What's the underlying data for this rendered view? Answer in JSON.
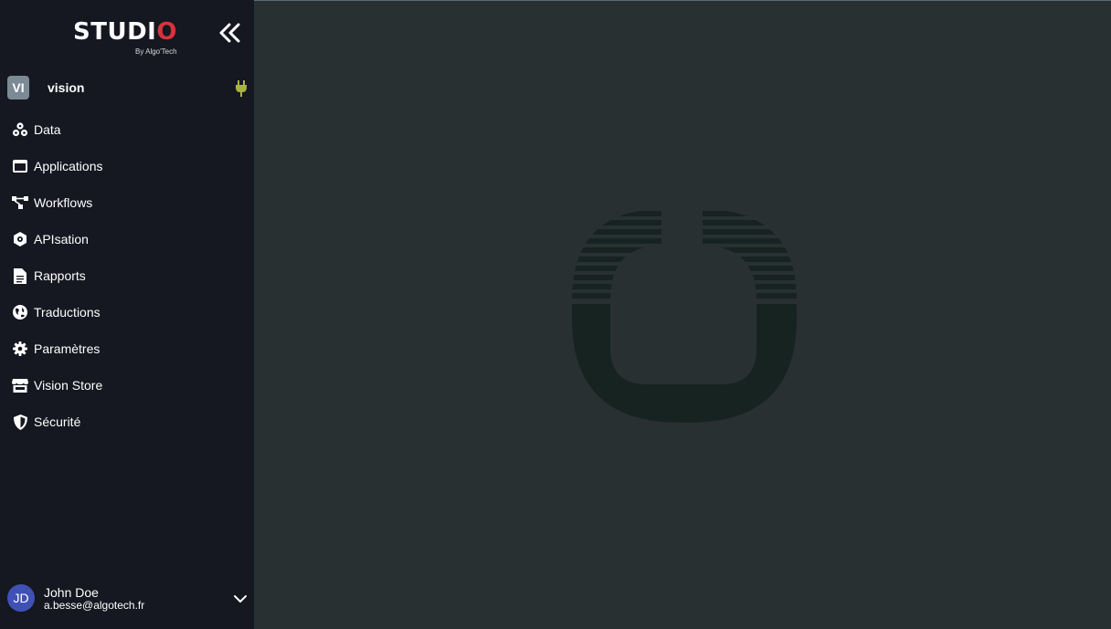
{
  "app": {
    "logo_main": "STUDI",
    "logo_accent": "O",
    "logo_sub": "By Algo'Tech"
  },
  "project": {
    "badge": "VI",
    "name": "vision"
  },
  "nav": {
    "items": [
      {
        "label": "Data",
        "icon": "database-icon"
      },
      {
        "label": "Applications",
        "icon": "window-icon"
      },
      {
        "label": "Workflows",
        "icon": "workflow-icon"
      },
      {
        "label": "APIsation",
        "icon": "api-gear-icon"
      },
      {
        "label": "Rapports",
        "icon": "document-icon"
      },
      {
        "label": "Traductions",
        "icon": "globe-icon"
      },
      {
        "label": "Paramètres",
        "icon": "gear-icon"
      },
      {
        "label": "Vision Store",
        "icon": "store-icon"
      },
      {
        "label": "Sécurité",
        "icon": "shield-icon"
      }
    ]
  },
  "user": {
    "initials": "JD",
    "name": "John Doe",
    "email": "a.besse@algotech.fr"
  },
  "colors": {
    "sidebar_bg": "#151721",
    "main_bg": "#293032",
    "logo_accent": "#d8333c",
    "plug_icon": "#a8b440",
    "avatar_bg": "#3f51b5",
    "watermark": "#172321"
  }
}
